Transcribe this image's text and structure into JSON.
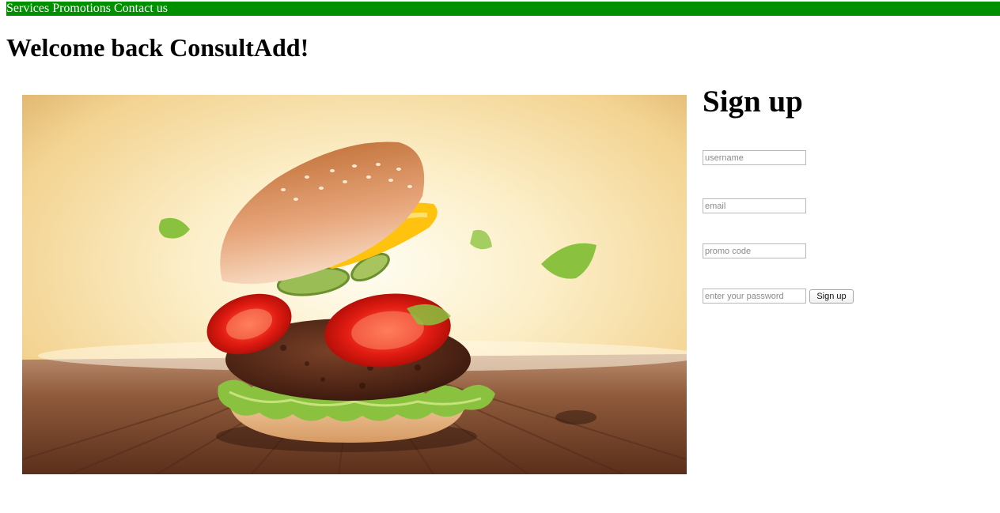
{
  "nav": {
    "links": [
      "Services",
      "Promotions",
      "Contact us"
    ],
    "background_color": "#009000",
    "text_color": "#ffffff"
  },
  "page": {
    "title": "Welcome back ConsultAdd!"
  },
  "hero": {
    "image_subject": "burger-with-floating-ingredients"
  },
  "signup": {
    "title": "Sign up",
    "username_placeholder": "username",
    "email_placeholder": "email",
    "promo_placeholder": "promo code",
    "password_placeholder": "enter your password",
    "button_label": "Sign up"
  }
}
